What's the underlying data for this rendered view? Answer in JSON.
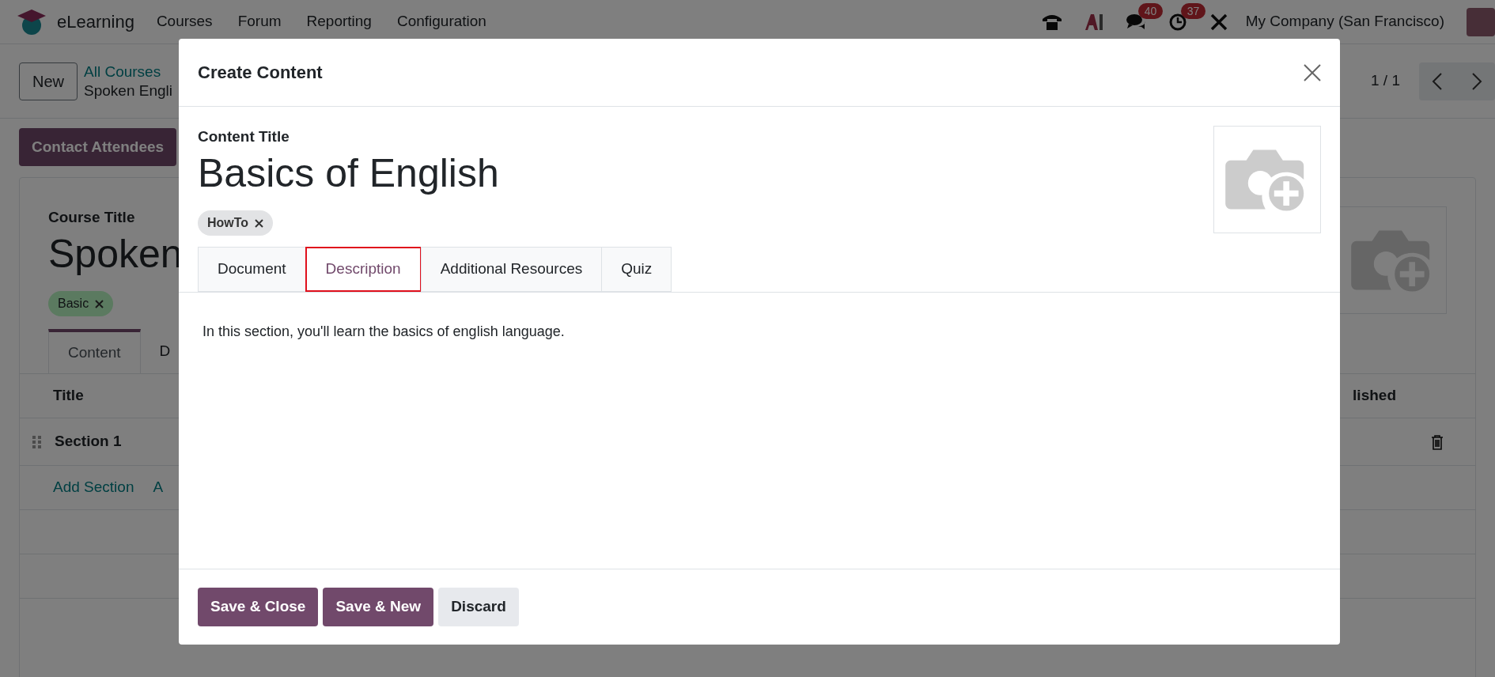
{
  "navbar": {
    "app": "eLearning",
    "menu": [
      "Courses",
      "Forum",
      "Reporting",
      "Configuration"
    ],
    "badges": [
      {
        "kind": "chat",
        "count": "40"
      },
      {
        "kind": "clock",
        "count": "37"
      }
    ],
    "company": "My Company (San Francisco)"
  },
  "control_panel": {
    "new_button": "New",
    "breadcrumb": "All Courses",
    "record": "Spoken Engli",
    "pager": "1 / 1"
  },
  "action_button": "Contact Attendees",
  "course": {
    "label": "Course Title",
    "title": "Spoken",
    "tags": [
      "Basic"
    ],
    "tabs": [
      {
        "label": "Content",
        "selected": true
      },
      {
        "label": "D",
        "selected": false
      }
    ],
    "columns": [
      "Title",
      "lished"
    ],
    "rows": [
      {
        "title": "Section 1"
      }
    ],
    "add_links": [
      "Add Section",
      "A"
    ]
  },
  "dialog": {
    "title": "Create Content",
    "field_label": "Content Title",
    "value": "Basics of English",
    "tags": [
      "HowTo"
    ],
    "tabs": [
      {
        "label": "Document",
        "selected": false,
        "highlighted": false
      },
      {
        "label": "Description",
        "selected": true,
        "highlighted": true
      },
      {
        "label": "Additional Resources",
        "selected": false,
        "highlighted": false
      },
      {
        "label": "Quiz",
        "selected": false,
        "highlighted": false
      }
    ],
    "description": "In this section, you'll learn the basics of english language.",
    "buttons": [
      {
        "label": "Save & Close",
        "kind": "primary"
      },
      {
        "label": "Save & New",
        "kind": "primary"
      },
      {
        "label": "Discard",
        "kind": "secondary"
      }
    ]
  }
}
